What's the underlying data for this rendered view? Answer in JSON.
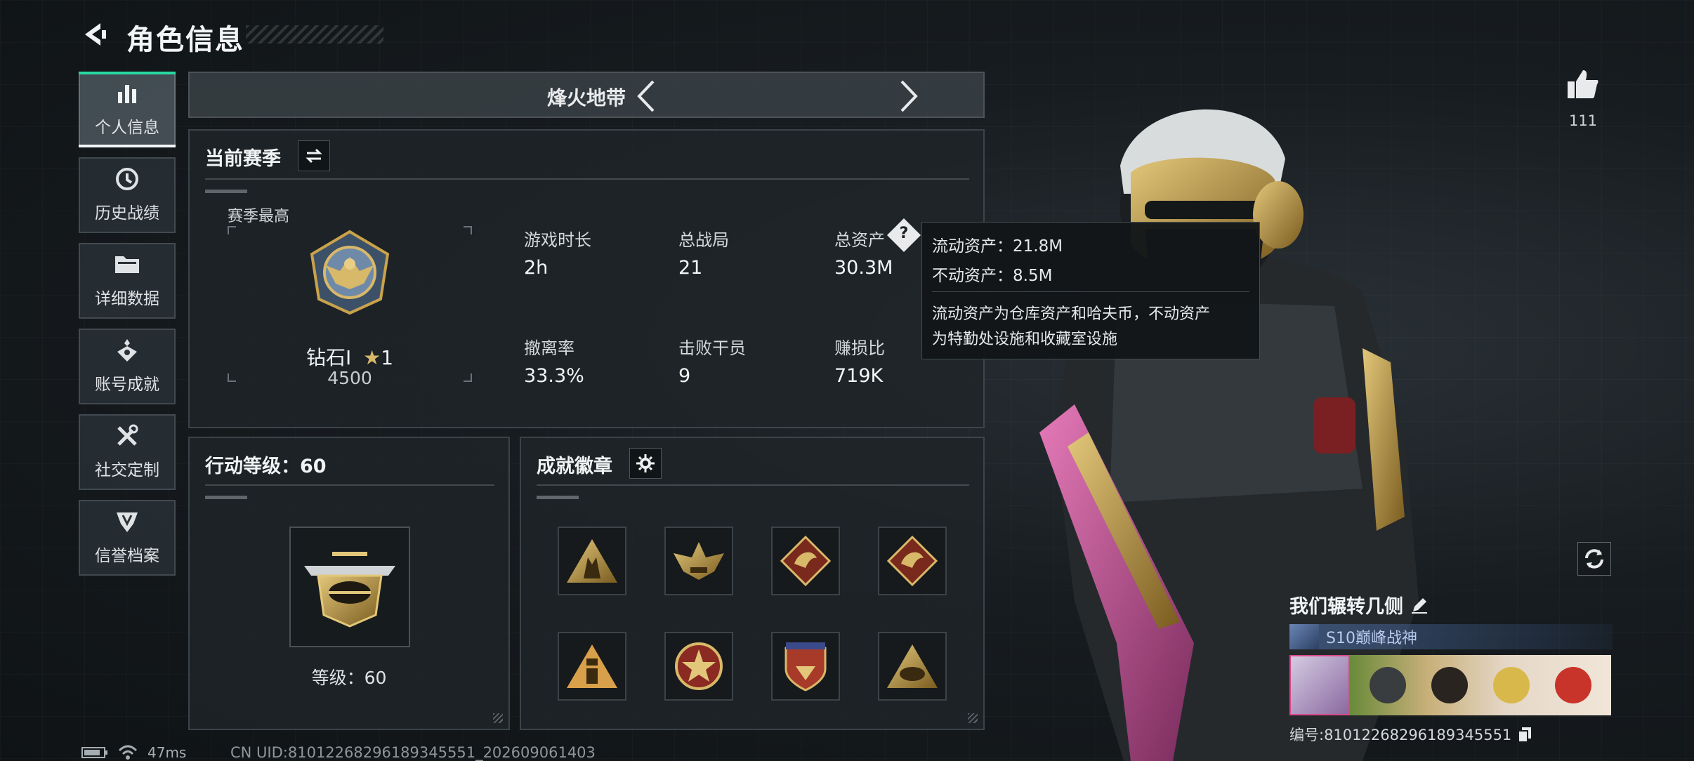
{
  "header": {
    "title": "角色信息"
  },
  "sidebar": {
    "items": [
      {
        "label": "个人信息",
        "icon": "bar-chart-icon",
        "active": true
      },
      {
        "label": "历史战绩",
        "icon": "history-clock-icon",
        "active": false
      },
      {
        "label": "详细数据",
        "icon": "folder-icon",
        "active": false
      },
      {
        "label": "账号成就",
        "icon": "achievement-icon",
        "active": false
      },
      {
        "label": "社交定制",
        "icon": "tools-icon",
        "active": false
      },
      {
        "label": "信誉档案",
        "icon": "shield-icon",
        "active": false
      }
    ]
  },
  "mode": {
    "name": "烽火地带"
  },
  "season": {
    "title": "当前赛季",
    "best_label": "赛季最高",
    "rank_name": "钻石I",
    "rank_stars": "1",
    "rank_score": "4500",
    "stats": [
      {
        "label": "游戏时长",
        "value": "2h"
      },
      {
        "label": "总战局",
        "value": "21"
      },
      {
        "label": "总资产",
        "value": "30.3M"
      },
      {
        "label": "撤离率",
        "value": "33.3%"
      },
      {
        "label": "击败干员",
        "value": "9"
      },
      {
        "label": "赚损比",
        "value": "719K"
      }
    ]
  },
  "tooltip": {
    "liquid": "流动资产：21.8M",
    "fixed": "不动资产：8.5M",
    "desc_line1": "流动资产为仓库资产和哈夫币，不动资产",
    "desc_line2": "为特勤处设施和收藏室设施"
  },
  "action": {
    "title": "行动等级：60",
    "level_text": "等级：60"
  },
  "badges": {
    "title": "成就徽章",
    "items": [
      {
        "icon": "badge-soldiers-icon"
      },
      {
        "icon": "badge-eagle-icon"
      },
      {
        "icon": "badge-dragon-icon"
      },
      {
        "icon": "badge-dragon-icon"
      },
      {
        "icon": "badge-tower-icon"
      },
      {
        "icon": "badge-star-seal-icon"
      },
      {
        "icon": "badge-shield-stars-icon"
      },
      {
        "icon": "badge-rhino-icon"
      }
    ]
  },
  "status": {
    "ping": "47ms",
    "uid": "CN UID:8101226829618934555​1_202609061403"
  },
  "likes": {
    "count": "111"
  },
  "player": {
    "name": "我们辗转几侧",
    "title": "S10巅峰战神",
    "id": "编号:8101226829618934555​1"
  },
  "colors": {
    "accent": "#27d9a0",
    "gold": "#c9a24a",
    "panel": "#1e2428"
  }
}
